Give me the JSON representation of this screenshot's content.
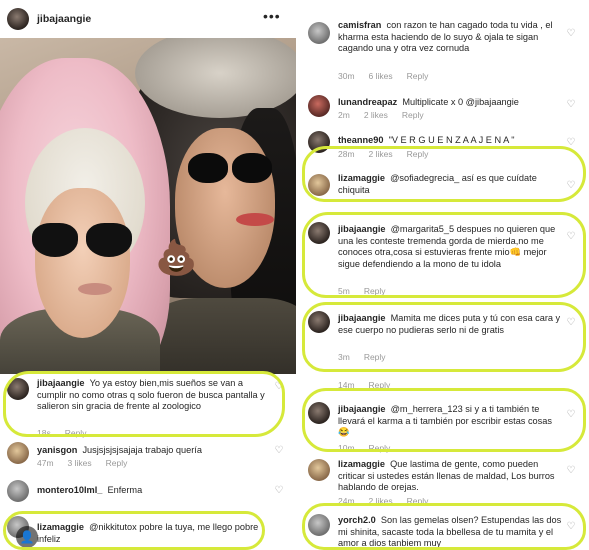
{
  "post": {
    "author": "jibajaangie",
    "more_icon": "more-dots-icon",
    "emoji": "💩"
  },
  "left_comments": [
    {
      "user": "jibajaangie",
      "text": "Yo ya estoy bien,mis sueños se van a cumplir no como otras q solo fueron de busca pantalla y salieron sin gracia de frente al zoologico",
      "time": "18s",
      "reply": "Reply"
    },
    {
      "user": "yanisgon",
      "text": "Jusjsjsjsjsajaja trabajo quería",
      "time": "47m",
      "likes": "3 likes",
      "reply": "Reply"
    },
    {
      "user": "montero10lml_",
      "text": "Enferma"
    },
    {
      "user": "lizamaggie",
      "text": "@nikkitutox pobre la tuya, me llego pobre infeliz"
    }
  ],
  "right_comments": [
    {
      "user": "camisfran",
      "text": "con razon te han cagado toda tu vida , el kharma esta haciendo de lo suyo & ojala te sigan cagando una y otra vez cornuda",
      "time": "30m",
      "likes": "6 likes",
      "reply": "Reply"
    },
    {
      "user": "lunandreapaz",
      "text": "Multiplicate x 0 @jibajaangie",
      "time": "2m",
      "likes": "2 likes",
      "reply": "Reply"
    },
    {
      "user": "theanne90",
      "text": "\"V E R G U E N Z A A J E N A \"",
      "time": "28m",
      "likes": "2 likes",
      "reply": "Reply"
    },
    {
      "user": "lizamaggie",
      "text": "@sofiadegrecia_ así es que cuídate chiquita"
    },
    {
      "user": "jibajaangie",
      "text": "@margarita5_5 despues no quieren que una les conteste tremenda gorda de mierda,no me conoces otra,cosa si estuvieras frente mio👊 mejor sigue defendiendo a la mono de tu idola",
      "time": "5m",
      "reply": "Reply"
    },
    {
      "user": "jibajaangie",
      "text": "Mamita me dices puta y tú con esa cara y ese cuerpo no pudieras serlo ni de gratis",
      "time": "3m",
      "reply": "Reply"
    },
    {
      "meta_only": true,
      "time": "14m",
      "reply": "Reply"
    },
    {
      "user": "jibajaangie",
      "text": "@m_herrera_123 si y a ti también te llevará el karma a ti también por escribir estas cosas😂",
      "time": "10m",
      "reply": "Reply"
    },
    {
      "user": "lizamaggie",
      "text": "Que lastima de gente, como pueden criticar si ustedes están llenas de maldad, Los burros hablando de orejas.",
      "time": "24m",
      "likes": "2 likes",
      "reply": "Reply"
    },
    {
      "user": "yorch2.0",
      "text": "Son las gemelas olsen? Estupendas las dos mi shinita, sacaste toda la bbellesa de tu mamita y el amor a dios tanbiem muy"
    }
  ],
  "colors": {
    "highlight": "#d6e93a",
    "username": "#262626",
    "meta": "#999999"
  },
  "icons": {
    "heart": "heart-icon",
    "profile": "profile-icon"
  },
  "watermark_symbol": "👤"
}
